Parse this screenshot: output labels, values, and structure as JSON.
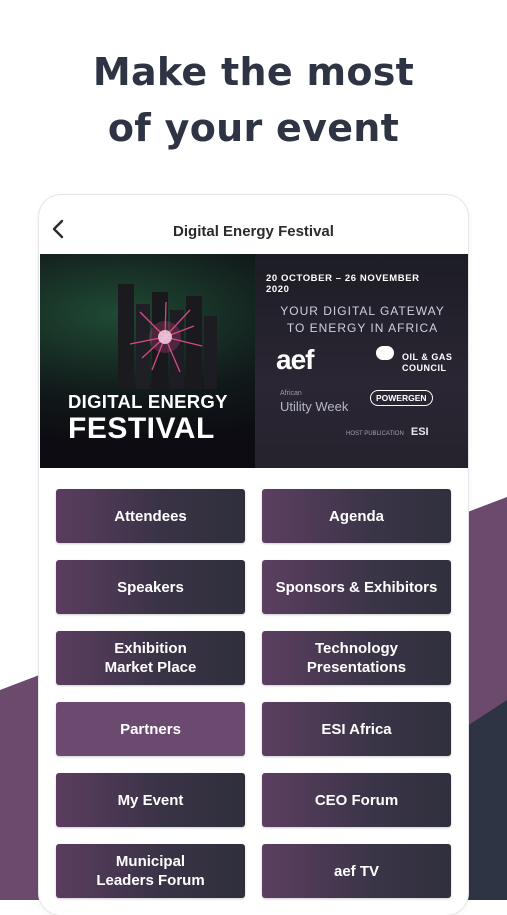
{
  "headline": {
    "line1": "Make the most",
    "line2": "of your event"
  },
  "topbar": {
    "title": "Digital Energy Festival",
    "back_icon": "chevron-left-icon"
  },
  "banner": {
    "dates": "20 OCTOBER – 26 NOVEMBER 2020",
    "tagline_line1": "YOUR DIGITAL GATEWAY",
    "tagline_line2": "TO ENERGY IN AFRICA",
    "name_line1": "DIGITAL ENERGY",
    "name_line2": "FESTIVAL",
    "logo_aef": "aef",
    "logo_oil_line1": "OIL & GAS",
    "logo_oil_line2": "COUNCIL",
    "logo_utility_small": "African",
    "logo_utility": "Utility Week",
    "logo_powergen": "POWERGEN",
    "logo_esi_small": "HOST PUBLICATION",
    "logo_esi": "ESI"
  },
  "tiles": [
    {
      "label": "Attendees"
    },
    {
      "label": "Agenda"
    },
    {
      "label": "Speakers"
    },
    {
      "label": "Sponsors & Exhibitors"
    },
    {
      "label": "Exhibition\nMarket Place"
    },
    {
      "label": "Technology\nPresentations"
    },
    {
      "label": "Partners"
    },
    {
      "label": "ESI Africa"
    },
    {
      "label": "My Event"
    },
    {
      "label": "CEO Forum"
    },
    {
      "label": "Municipal\nLeaders Forum"
    },
    {
      "label": "aef TV"
    }
  ],
  "colors": {
    "headline": "#2e3443",
    "tile_purple": "#6a4a6e",
    "tile_dark": "#30303d",
    "bg_shape_purple": "#6b4a6d",
    "bg_shape_dark": "#2f3444"
  }
}
